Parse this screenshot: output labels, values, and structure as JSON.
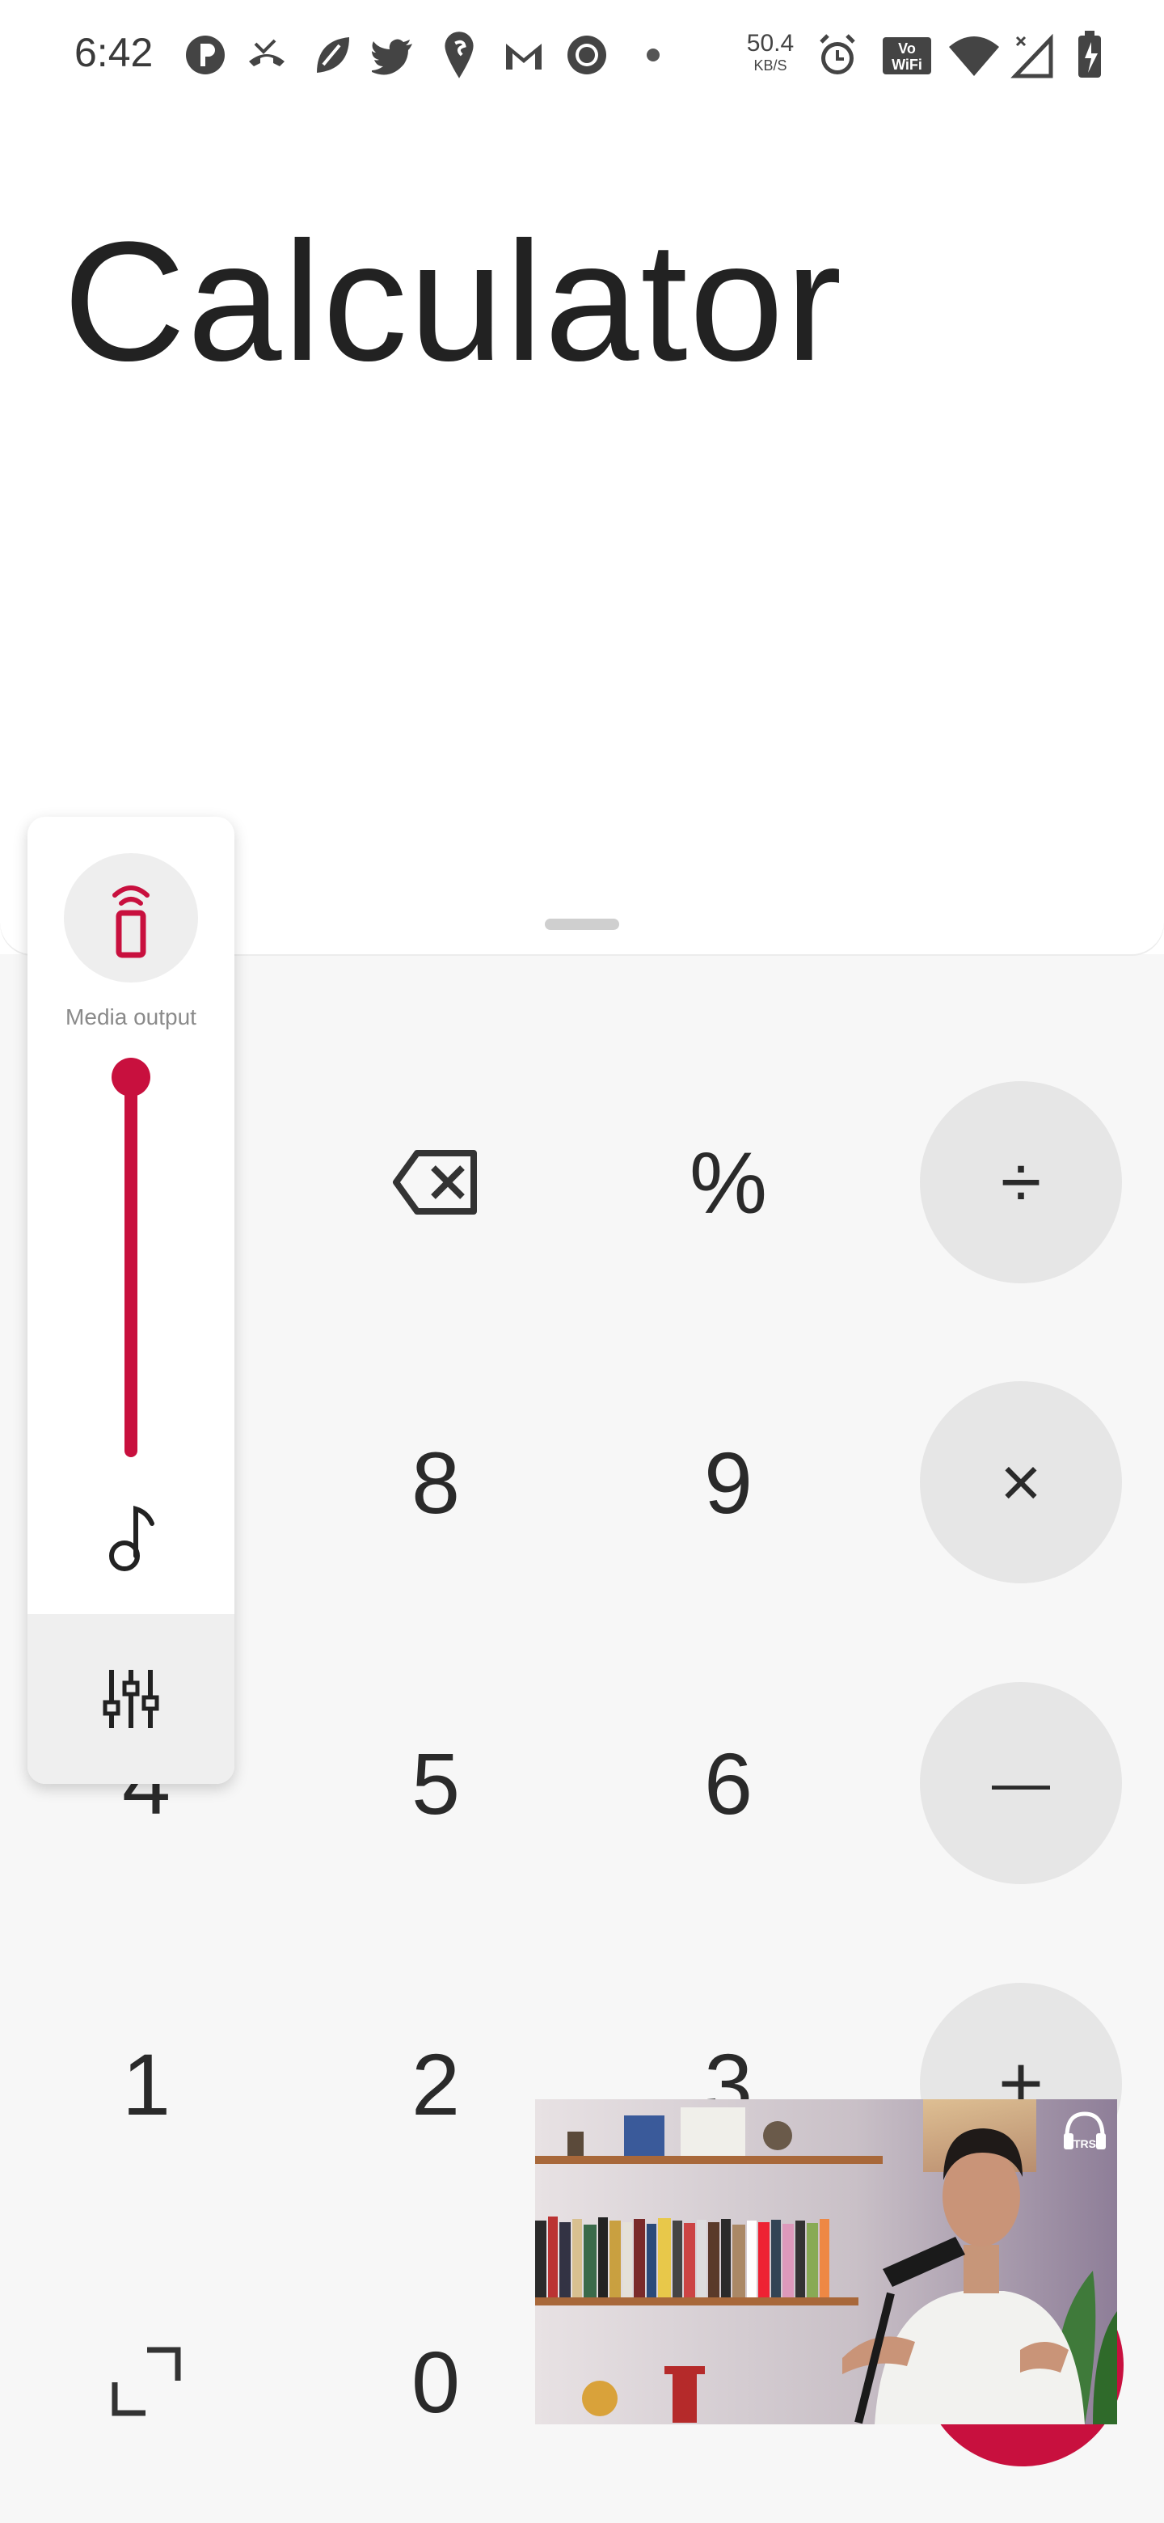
{
  "status_bar": {
    "time": "6:42",
    "net_speed_value": "50.4",
    "net_speed_unit": "KB/S",
    "icons": [
      "pill-p-icon",
      "missed-call-icon",
      "leaf-app-icon",
      "twitter-icon",
      "swiggy-icon",
      "gmail-icon",
      "record-icon",
      "dot-icon",
      "alarm-icon",
      "vowifi-icon",
      "wifi-icon",
      "signal-icon",
      "battery-charging-icon"
    ]
  },
  "app": {
    "title": "Calculator"
  },
  "volume_panel": {
    "output_label": "Media output",
    "level": 1.0,
    "accent_color": "#c8103e",
    "icons": [
      "cast-phone-icon",
      "music-note-icon",
      "equalizer-icon"
    ]
  },
  "keypad": {
    "keys": [
      {
        "name": "backspace",
        "label": "",
        "icon": "backspace-icon"
      },
      {
        "name": "percent",
        "label": "%"
      },
      {
        "name": "divide",
        "label": "÷"
      },
      {
        "name": "eight",
        "label": "8"
      },
      {
        "name": "nine",
        "label": "9"
      },
      {
        "name": "multiply",
        "label": "×"
      },
      {
        "name": "five",
        "label": "5"
      },
      {
        "name": "six",
        "label": "6"
      },
      {
        "name": "minus",
        "label": "—"
      },
      {
        "name": "one",
        "label": "1"
      },
      {
        "name": "two",
        "label": "2"
      },
      {
        "name": "three",
        "label": "3"
      },
      {
        "name": "plus",
        "label": "+"
      },
      {
        "name": "expand",
        "label": "",
        "icon": "expand-icon"
      },
      {
        "name": "zero",
        "label": "0"
      }
    ],
    "operator_bg": "#e6e6e6",
    "equals_color": "#c8103e"
  },
  "pip_video": {
    "badge_text": "TRS"
  }
}
